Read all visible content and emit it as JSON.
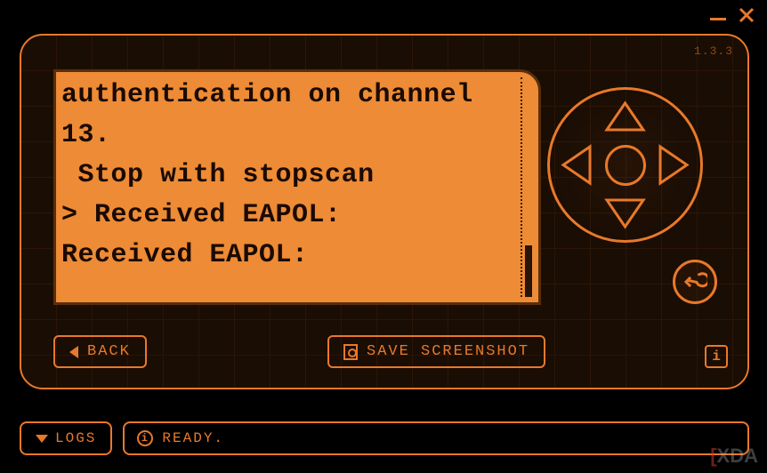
{
  "version": "1.3.3",
  "screen": {
    "lines": [
      "authentication on channel 13.",
      " Stop with stopscan",
      "> Received EAPOL:",
      "Received EAPOL:"
    ]
  },
  "buttons": {
    "back": "BACK",
    "save_screenshot": "SAVE SCREENSHOT",
    "logs": "LOGS"
  },
  "status": {
    "text": "READY."
  },
  "watermark": {
    "prefix": "[",
    "text": "XDA"
  }
}
